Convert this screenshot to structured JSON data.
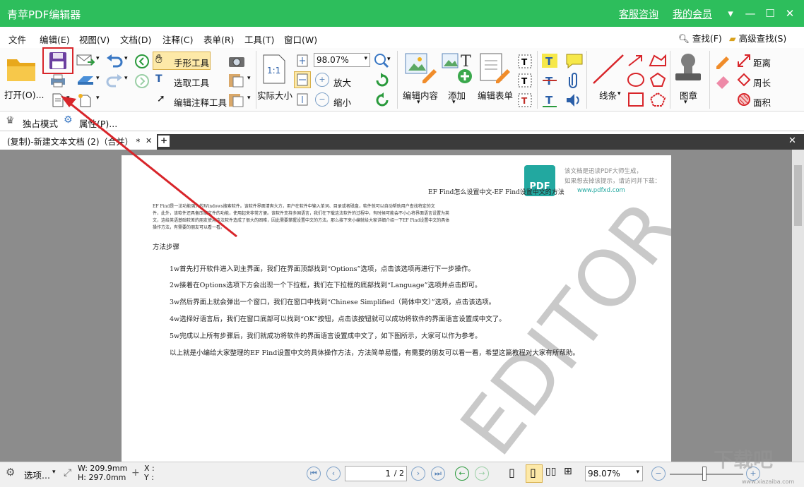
{
  "app": {
    "title": "青苹PDF编辑器",
    "support": "客服咨询",
    "member": "我的会员"
  },
  "menu": [
    "文件",
    "编辑(E)",
    "视图(V)",
    "文档(D)",
    "注释(C)",
    "表单(R)",
    "工具(T)",
    "窗口(W)"
  ],
  "menu_right": {
    "find": "查找(F)",
    "adv_find": "高级查找(S)"
  },
  "ribbon": {
    "open": "打开(O)...",
    "hand": "手形工具",
    "select": "选取工具",
    "edit_annot": "编辑注释工具",
    "actual_size": "实际大小",
    "zoom_value": "98.07%",
    "zoom_in": "放大",
    "zoom_out": "缩小",
    "edit_content": "编辑内容",
    "add": "添加",
    "edit_form": "编辑表单",
    "lines": "线条",
    "stamp": "图章",
    "distance": "距离",
    "perimeter": "周长",
    "area": "面积"
  },
  "mode": {
    "exclusive": "独占模式",
    "properties": "属性(P)..."
  },
  "tab": {
    "title": "(复制)-新建文本文档 (2)（合并） *"
  },
  "page": {
    "header": "EF Find怎么设置中文-EF Find设置中文的方法",
    "wm_line1": "该文档是迅读PDF大师生成，",
    "wm_line2": "如果想去掉该提示，请访问并下载：",
    "wm_url": "www.pdfxd.com",
    "wm_logo": "PDF",
    "para1_l1": "EF Find是一法功能强大的Windows搜索软件。该软件界面清爽大方，用户在软件中输入单词、目录或者磁盘，软件就可以自动帮助用户查找特定的文",
    "para1_l2": "件，此外，该软件还具备压缩文件的功能，使用起来非常方便。该软件支持多国语言，我们在下载这法软件的过程中，有时候可能会不小心将界面语言设置为英",
    "para1_l3": "文，这给英语基础较差的朋友使用这法软件造成了很大的困难，因此需要掌握设置中文的方法。那么接下来小编就给大家详细介绍一下EF Find设置中文的具体",
    "para1_l4": "操作方法，有需要的朋友可以看一看。",
    "section": "方法步骤",
    "steps": [
      "1w首先打开软件进入到主界面，我们在界面顶部找到“Options”选项，点击该选项再进行下一步操作。",
      "2w接着在Options选项下方会出现一个下拉框，我们在下拉框的底部找到“Language”选项并点击即可。",
      "3w然后界面上就会弹出一个窗口，我们在窗口中找到“Chinese Simplified（简体中文）”选项，点击该选项。",
      "4w选择好语言后，我们在窗口底部可以找到“OK”按钮，点击该按钮就可以成功将软件的界面语言设置成中文了。",
      "5w完成以上所有步骤后，我们就成功将软件的界面语言设置成中文了，如下图所示，大家可以作为参考。",
      "以上就是小编给大家整理的EF Find设置中文的具体操作方法，方法简单易懂，有需要的朋友可以看一看，希望这篇教程对大家有所帮助。"
    ],
    "watermark": "EDITOR"
  },
  "status": {
    "options": "选项...",
    "width": "W: 209.9mm",
    "height": "H: 297.0mm",
    "x": "X :",
    "y": "Y :",
    "page_input": "1",
    "page_total": "/ 2",
    "zoom": "98.07%"
  },
  "site_watermark": "下载吧",
  "site_url": "www.xiazaiba.com",
  "colors": {
    "titlebar": "#2dbe5c",
    "highlight": "#d8252a",
    "arrow": "#d8252a"
  }
}
